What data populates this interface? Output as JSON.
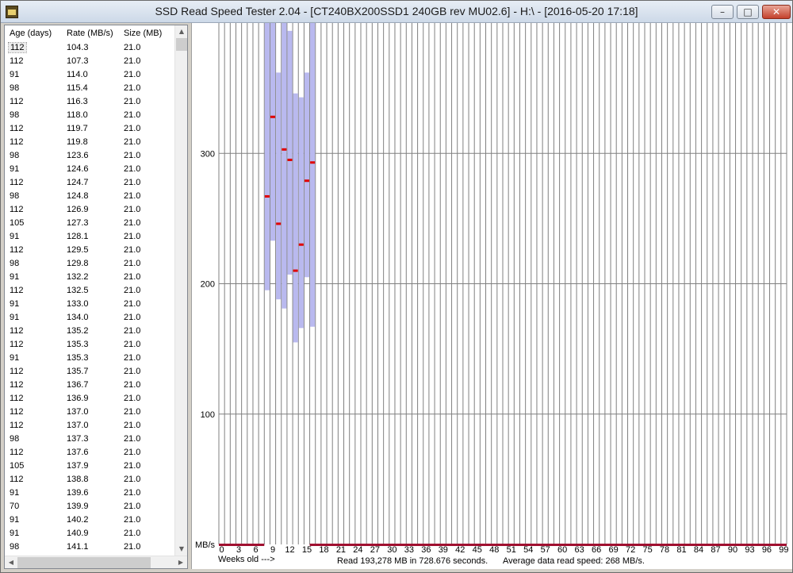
{
  "window": {
    "title": "SSD Read Speed Tester 2.04 - [CT240BX200SSD1 240GB rev MU02.6] - H:\\ - [2016-05-20 17:18]",
    "minimize_label": "–",
    "maximize_label": "□",
    "close_label": "✕"
  },
  "file_list": {
    "columns": [
      "Age (days)",
      "Rate (MB/s)",
      "Size (MB)"
    ],
    "rows": [
      [
        "112",
        "104.3",
        "21.0"
      ],
      [
        "112",
        "107.3",
        "21.0"
      ],
      [
        "91",
        "114.0",
        "21.0"
      ],
      [
        "98",
        "115.4",
        "21.0"
      ],
      [
        "112",
        "116.3",
        "21.0"
      ],
      [
        "98",
        "118.0",
        "21.0"
      ],
      [
        "112",
        "119.7",
        "21.0"
      ],
      [
        "112",
        "119.8",
        "21.0"
      ],
      [
        "98",
        "123.6",
        "21.0"
      ],
      [
        "91",
        "124.6",
        "21.0"
      ],
      [
        "112",
        "124.7",
        "21.0"
      ],
      [
        "98",
        "124.8",
        "21.0"
      ],
      [
        "112",
        "126.9",
        "21.0"
      ],
      [
        "105",
        "127.3",
        "21.0"
      ],
      [
        "91",
        "128.1",
        "21.0"
      ],
      [
        "112",
        "129.5",
        "21.0"
      ],
      [
        "98",
        "129.8",
        "21.0"
      ],
      [
        "91",
        "132.2",
        "21.0"
      ],
      [
        "112",
        "132.5",
        "21.0"
      ],
      [
        "91",
        "133.0",
        "21.0"
      ],
      [
        "91",
        "134.0",
        "21.0"
      ],
      [
        "112",
        "135.2",
        "21.0"
      ],
      [
        "112",
        "135.3",
        "21.0"
      ],
      [
        "91",
        "135.3",
        "21.0"
      ],
      [
        "112",
        "135.7",
        "21.0"
      ],
      [
        "112",
        "136.7",
        "21.0"
      ],
      [
        "112",
        "136.9",
        "21.0"
      ],
      [
        "112",
        "137.0",
        "21.0"
      ],
      [
        "112",
        "137.0",
        "21.0"
      ],
      [
        "98",
        "137.3",
        "21.0"
      ],
      [
        "112",
        "137.6",
        "21.0"
      ],
      [
        "105",
        "137.9",
        "21.0"
      ],
      [
        "112",
        "138.8",
        "21.0"
      ],
      [
        "91",
        "139.6",
        "21.0"
      ],
      [
        "70",
        "139.9",
        "21.0"
      ],
      [
        "91",
        "140.2",
        "21.0"
      ],
      [
        "91",
        "140.9",
        "21.0"
      ],
      [
        "98",
        "141.1",
        "21.0"
      ]
    ],
    "selected_row": 0
  },
  "chart_data": {
    "type": "bar",
    "ylabel": "MB/s",
    "xlabel": "Weeks old --->",
    "ylim": [
      0,
      400
    ],
    "xlim": [
      0,
      100
    ],
    "y_ticks": [
      100,
      200,
      300
    ],
    "x_ticks": [
      0,
      3,
      6,
      9,
      12,
      15,
      18,
      21,
      24,
      27,
      30,
      33,
      36,
      39,
      42,
      45,
      48,
      51,
      54,
      57,
      60,
      63,
      66,
      69,
      72,
      75,
      78,
      81,
      84,
      87,
      90,
      93,
      96,
      99
    ],
    "grid": true,
    "colors": {
      "range_bar": "#b9b9ef",
      "average": "#e00000",
      "baseline": "#a01030",
      "grid": "#808080"
    },
    "weeks": [
      {
        "week": 8,
        "min": 195,
        "max": 400,
        "avg": 267
      },
      {
        "week": 9,
        "min": 233,
        "max": 400,
        "avg": 328
      },
      {
        "week": 10,
        "min": 188,
        "max": 362,
        "avg": 246
      },
      {
        "week": 11,
        "min": 181,
        "max": 400,
        "avg": 303
      },
      {
        "week": 12,
        "min": 207,
        "max": 394,
        "avg": 295
      },
      {
        "week": 13,
        "min": 155,
        "max": 346,
        "avg": 210
      },
      {
        "week": 14,
        "min": 166,
        "max": 343,
        "avg": 230
      },
      {
        "week": 15,
        "min": 205,
        "max": 362,
        "avg": 279
      },
      {
        "week": 16,
        "min": 167,
        "max": 400,
        "avg": 293
      }
    ],
    "baseline_ranges": [
      [
        0,
        8
      ],
      [
        16,
        100
      ]
    ]
  },
  "status": {
    "read_summary": "Read 193,278 MB in 728.676 seconds.",
    "average_speed": "Average data read speed: 268 MB/s."
  }
}
